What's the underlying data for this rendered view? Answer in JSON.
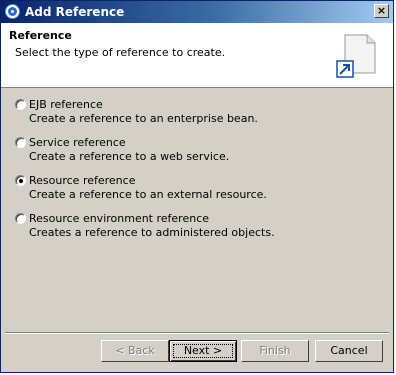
{
  "window": {
    "title": "Add Reference",
    "close_label": "×"
  },
  "header": {
    "title": "Reference",
    "description": "Select the type of reference to create.",
    "image_icon": "new-file-wizard-icon"
  },
  "options": [
    {
      "label": "EJB reference",
      "description": "Create a reference to an enterprise bean.",
      "selected": false
    },
    {
      "label": "Service reference",
      "description": "Create a reference to a web service.",
      "selected": false
    },
    {
      "label": "Resource reference",
      "description": "Create a reference to an external resource.",
      "selected": true
    },
    {
      "label": "Resource environment reference",
      "description": "Creates a reference to administered objects.",
      "selected": false
    }
  ],
  "buttons": {
    "back": "< Back",
    "next": "Next >",
    "finish": "Finish",
    "cancel": "Cancel"
  },
  "colors": {
    "titlebar": "#0a246a",
    "dialog_bg": "#d4d0c8",
    "header_bg": "#ffffff",
    "arrow": "#1f4e9c"
  }
}
